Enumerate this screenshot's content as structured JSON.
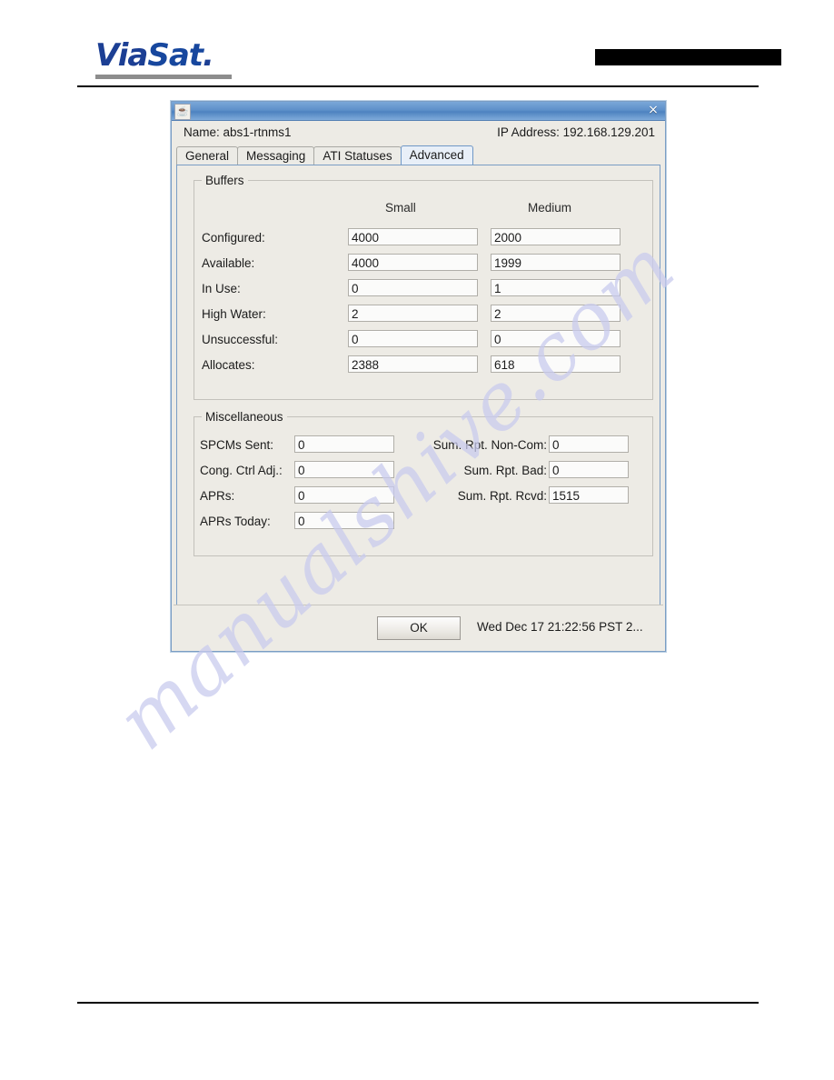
{
  "page": {
    "logo": {
      "text_left": "Via",
      "text_right": "Sat",
      "suffix": "."
    },
    "redaction_label": "redaction-bar"
  },
  "watermark": {
    "text": "manualshive.com"
  },
  "dialog": {
    "icon": "java-cup-icon",
    "close_label": "×",
    "info": {
      "name_label": "Name:  abs1-rtnms1",
      "ip_label": "IP Address:  192.168.129.201"
    },
    "tabs": [
      {
        "label": "General",
        "selected": false
      },
      {
        "label": "Messaging",
        "selected": false
      },
      {
        "label": "ATI Statuses",
        "selected": false
      },
      {
        "label": "Advanced",
        "selected": true
      }
    ],
    "buffers": {
      "title": "Buffers",
      "columns": [
        "Small",
        "Medium"
      ],
      "rows": [
        {
          "label": "Configured:",
          "small": "4000",
          "medium": "2000"
        },
        {
          "label": "Available:",
          "small": "4000",
          "medium": "1999"
        },
        {
          "label": "In Use:",
          "small": "0",
          "medium": "1"
        },
        {
          "label": "High Water:",
          "small": "2",
          "medium": "2"
        },
        {
          "label": "Unsuccessful:",
          "small": "0",
          "medium": "0"
        },
        {
          "label": "Allocates:",
          "small": "2388",
          "medium": "618"
        }
      ]
    },
    "miscellaneous": {
      "title": "Miscellaneous",
      "left_rows": [
        {
          "label": "SPCMs Sent:",
          "value": "0"
        },
        {
          "label": "Cong. Ctrl Adj.:",
          "value": "0"
        },
        {
          "label": "APRs:",
          "value": "0"
        },
        {
          "label": "APRs Today:",
          "value": "0"
        }
      ],
      "right_rows": [
        {
          "label": "Sum. Rpt. Non-Com:",
          "value": "0"
        },
        {
          "label": "Sum. Rpt. Bad:",
          "value": "0"
        },
        {
          "label": "Sum. Rpt. Rcvd:",
          "value": "1515"
        }
      ]
    },
    "footer": {
      "ok_label": "OK",
      "timestamp": "Wed Dec 17 21:22:56 PST 2..."
    }
  }
}
